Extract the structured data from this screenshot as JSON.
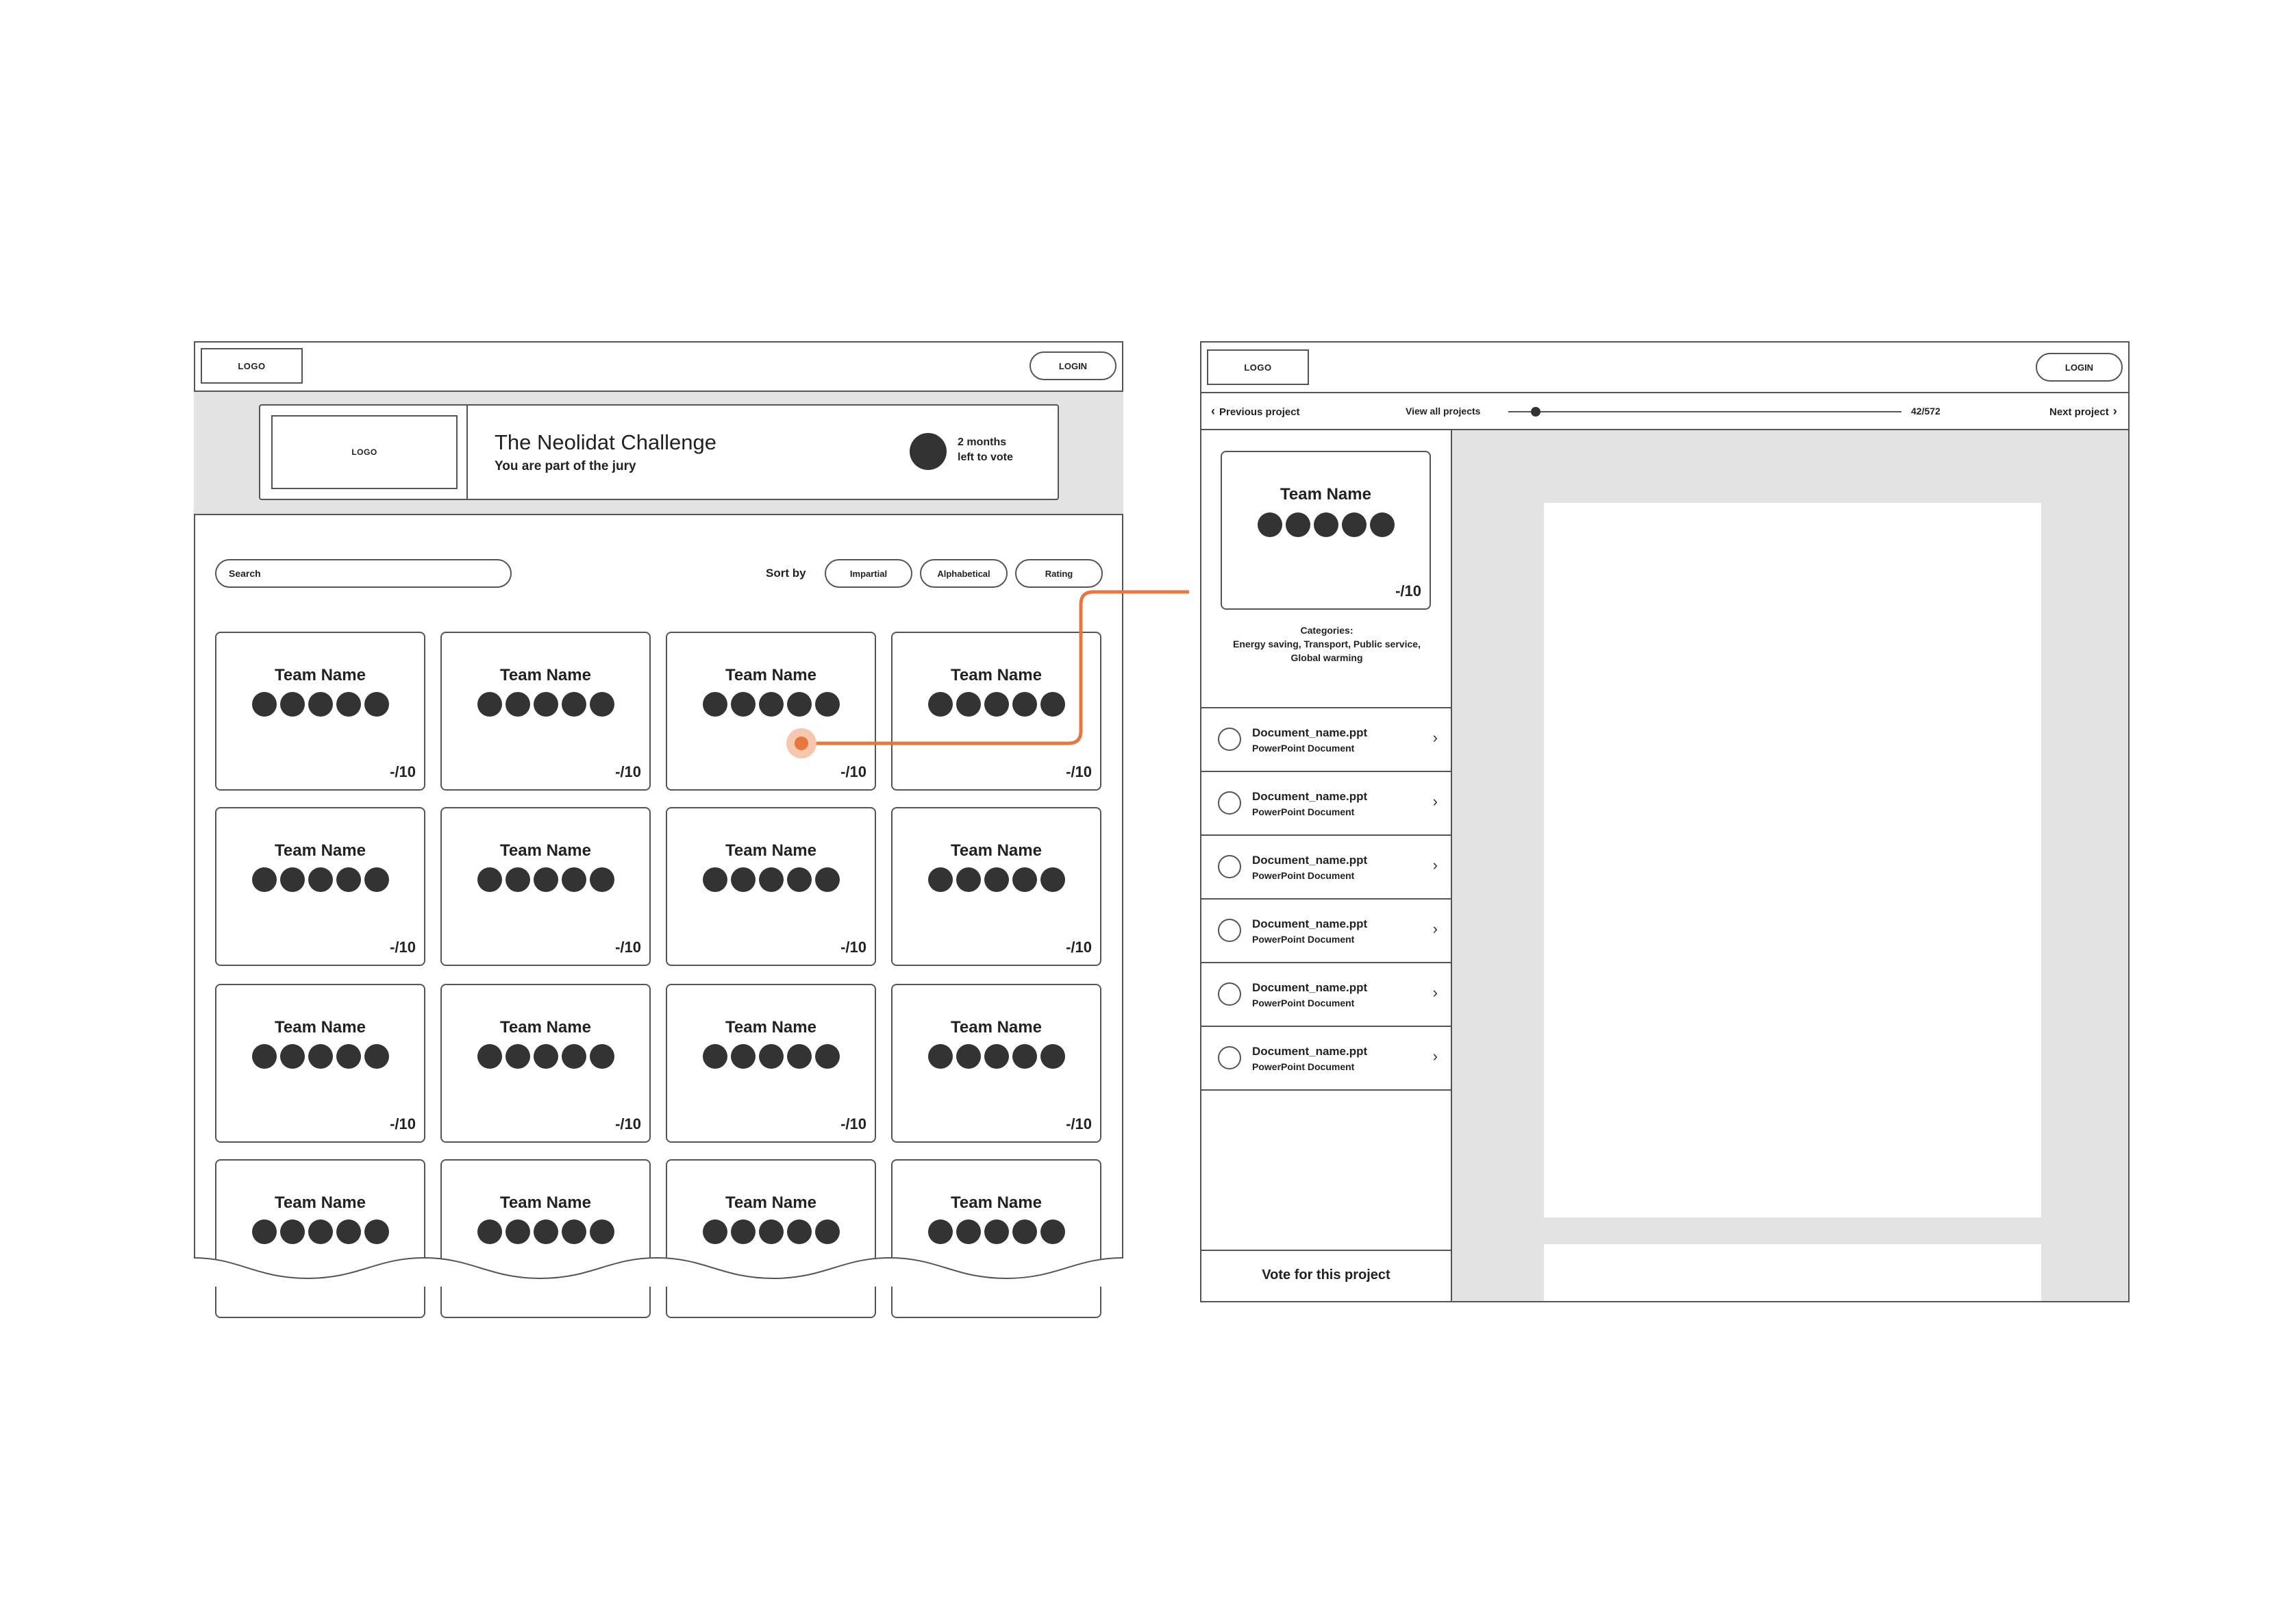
{
  "left_screen": {
    "header": {
      "logo_text": "LOGO",
      "login_label": "LOGIN"
    },
    "banner": {
      "logo_text": "LOGO",
      "title": "The Neolidat Challenge",
      "subtitle": "You are part of the jury",
      "deadline_line1": "2 months",
      "deadline_line2": "left to vote"
    },
    "toolbar": {
      "search_placeholder": "Search",
      "sort_label": "Sort by",
      "sort_options": [
        "Impartial",
        "Alphabetical",
        "Rating"
      ]
    },
    "cards": [
      {
        "name": "Team Name",
        "score": "-/10"
      },
      {
        "name": "Team Name",
        "score": "-/10"
      },
      {
        "name": "Team Name",
        "score": "-/10"
      },
      {
        "name": "Team Name",
        "score": "-/10"
      },
      {
        "name": "Team Name",
        "score": "-/10"
      },
      {
        "name": "Team Name",
        "score": "-/10"
      },
      {
        "name": "Team Name",
        "score": "-/10"
      },
      {
        "name": "Team Name",
        "score": "-/10"
      },
      {
        "name": "Team Name",
        "score": "-/10"
      },
      {
        "name": "Team Name",
        "score": "-/10"
      },
      {
        "name": "Team Name",
        "score": "-/10"
      },
      {
        "name": "Team Name",
        "score": "-/10"
      },
      {
        "name": "Team Name"
      },
      {
        "name": "Team Name"
      },
      {
        "name": "Team Name"
      },
      {
        "name": "Team Name"
      }
    ]
  },
  "right_screen": {
    "header": {
      "logo_text": "LOGO",
      "login_label": "LOGIN"
    },
    "nav": {
      "previous_label": "Previous project",
      "view_all_label": "View all projects",
      "counter": "42/572",
      "slider_fraction": 0.07,
      "next_label": "Next project"
    },
    "team_card": {
      "name": "Team Name",
      "score": "-/10"
    },
    "categories": {
      "label": "Categories:",
      "line1": "Energy saving, Transport, Public service,",
      "line2": "Global warming"
    },
    "documents": [
      {
        "name": "Document_name.ppt",
        "type": "PowerPoint Document"
      },
      {
        "name": "Document_name.ppt",
        "type": "PowerPoint Document"
      },
      {
        "name": "Document_name.ppt",
        "type": "PowerPoint Document"
      },
      {
        "name": "Document_name.ppt",
        "type": "PowerPoint Document"
      },
      {
        "name": "Document_name.ppt",
        "type": "PowerPoint Document"
      },
      {
        "name": "Document_name.ppt",
        "type": "PowerPoint Document"
      }
    ],
    "vote_label": "Vote for this project"
  },
  "colors": {
    "accent": "#e8773f",
    "accent_soft": "#f6c7ae",
    "line": "#555555",
    "panel_gray": "#e3e3e3",
    "dot": "#333333"
  },
  "icons": {
    "previous": "chevron-left-icon",
    "next": "chevron-right-icon",
    "doc_row": "chevron-right-icon",
    "timer": "circle-icon"
  }
}
